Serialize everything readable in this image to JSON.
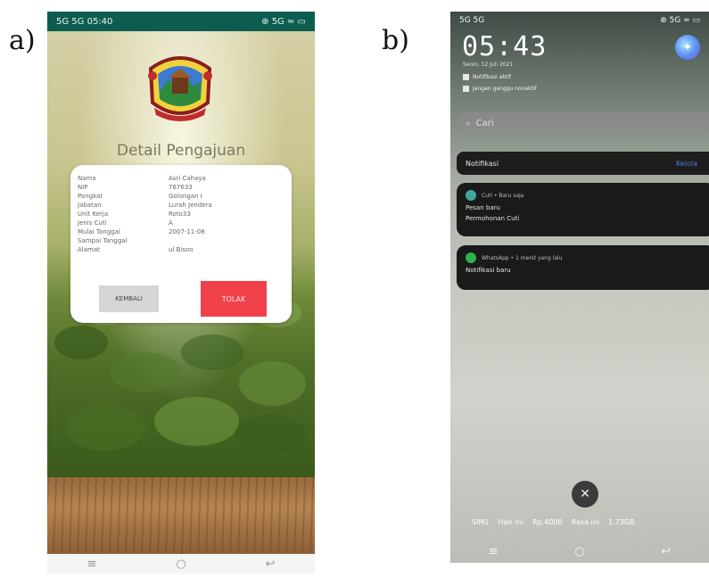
{
  "labels": {
    "a": "a)",
    "b": "b)"
  },
  "phone_a": {
    "status": {
      "left": "5G 5G 05:40",
      "right": "⊕ 5G ≈ ▭"
    },
    "title": "Detail Pengajuan",
    "rows": [
      {
        "key": "Nama",
        "value": "Asri Cahaya"
      },
      {
        "key": "NIP",
        "value": "767633"
      },
      {
        "key": "Pangkat",
        "value": "Golongan I"
      },
      {
        "key": "Jabatan",
        "value": "Lurah Jendera"
      },
      {
        "key": "Unit Kerja",
        "value": "Roto33"
      },
      {
        "key": "Jenis Cuti",
        "value": "A"
      },
      {
        "key": "Mulai Tanggal",
        "value": "2007-11-08"
      },
      {
        "key": "Sampai Tanggal",
        "value": ""
      },
      {
        "key": "Alamat",
        "value": "ul Bisoo"
      }
    ],
    "buttons": {
      "back": "KEMBALI",
      "reject": "TOLAK"
    },
    "nav": {
      "menu": "≡",
      "home": "○",
      "back": "↩"
    }
  },
  "phone_b": {
    "status": {
      "left": "5G 5G",
      "right": "⊕ 5G ≈ ▭"
    },
    "time": "05:43",
    "date": "Senin, 12 Juli 2021",
    "mini_items": [
      "Notifikasi aktif",
      "Jangan ganggu nonaktif"
    ],
    "search_placeholder": "Cari",
    "notif_header": {
      "label": "Notifikasi",
      "manage": "Kelola"
    },
    "notifications": [
      {
        "app": "Cuti",
        "meta": "Cuti • Baru saja",
        "lines": [
          "Pesan baru",
          "Permohonan Cuti"
        ],
        "color": "#3fa7a0"
      },
      {
        "app": "WhatsApp",
        "meta": "WhatsApp • 1 menit yang lalu",
        "lines": [
          "Notifikasi baru"
        ],
        "color": "#2fb24c"
      }
    ],
    "dismiss": "✕",
    "bottom_strip": [
      "SIM1",
      "Hari Ini",
      "Rp.4000",
      "Rasa ini",
      "1.73GB"
    ],
    "nav": {
      "menu": "≡",
      "home": "○",
      "back": "↩"
    }
  }
}
